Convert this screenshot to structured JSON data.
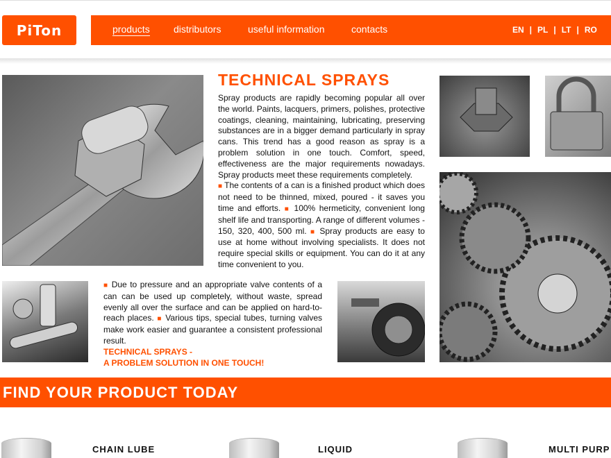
{
  "logo": {
    "text": "PiTon"
  },
  "nav": {
    "items": [
      "products",
      "distributors",
      "useful information",
      "contacts"
    ],
    "active": "products"
  },
  "languages": [
    "EN",
    "PL",
    "LT",
    "RO"
  ],
  "article": {
    "title": "TECHNICAL SPRAYS",
    "para1": "Spray products are rapidly becoming popular all over the world. Paints, lacquers, primers, polishes, protective coatings, cleaning, maintaining, lubricating, preserving substances are in a bigger demand particularly in spray cans. This trend has a good reason as spray is a problem solution in one touch. Comfort, speed, effectiveness are the major requirements nowadays. Spray products meet these requirements completely.",
    "para2a": "The contents of a can is a finished product which does not need to be thinned, mixed, poured - it saves you time and efforts.",
    "para2b": "100% hermeticity, convenient long shelf life and transporting. A range of different volumes - 150, 320, 400, 500 ml.",
    "para2c": "Spray products are easy to use at home without involving specialists. It does not require special skills or equipment. You can do it at any time convenient to you.",
    "para3a": "Due to pressure and an appropriate valve contents of a can can be used up completely, without waste, spread evenly all over the surface and can be applied on hard-to-reach places.",
    "para3b": "Various tips, special tubes, turning valves make work easier and guarantee a consistent professional result.",
    "tagline1": "TECHNICAL SPRAYS -",
    "tagline2": "A PROBLEM SOLUTION IN ONE TOUCH!"
  },
  "banner": {
    "text": "FIND YOUR PRODUCT TODAY"
  },
  "products": [
    {
      "name": "CHAIN LUBE"
    },
    {
      "name": "LIQUID"
    },
    {
      "name": "MULTI PURP"
    }
  ],
  "colors": {
    "accent": "#ff5000",
    "text": "#111111",
    "background": "#ffffff"
  }
}
